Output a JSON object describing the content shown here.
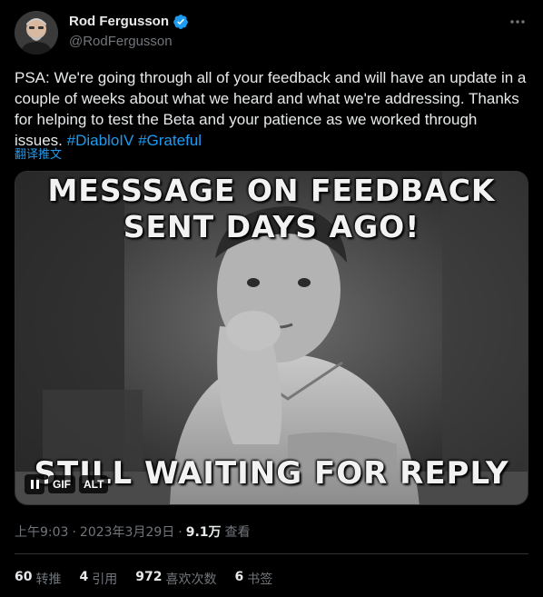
{
  "author": {
    "name": "Rod Fergusson",
    "handle": "@RodFergusson",
    "verified": true
  },
  "tweet": {
    "text": "PSA: We're going through all of your feedback and will have an update in a couple of weeks about what we heard and what we're addressing. Thanks for helping to test the Beta and your patience as we worked through issues. ",
    "hashtags": [
      "#DiabloIV",
      "#Grateful"
    ],
    "translate_label": "翻译推文"
  },
  "media": {
    "caption_top_line1": "MESSSAGE ON FEEDBACK",
    "caption_top_line2": "SENT  DAYS AGO!",
    "caption_bottom": "STILL WAITING FOR REPLY",
    "gif_badge": "GIF",
    "alt_badge": "ALT"
  },
  "meta": {
    "time": "上午9:03",
    "separator": "·",
    "date": "2023年3月29日",
    "views_count": "9.1万",
    "views_label": "查看"
  },
  "stats": {
    "retweets": {
      "count": "60",
      "label": "转推"
    },
    "quotes": {
      "count": "4",
      "label": "引用"
    },
    "likes": {
      "count": "972",
      "label": "喜欢次数"
    },
    "bookmarks": {
      "count": "6",
      "label": "书签"
    }
  },
  "colors": {
    "background": "#000000",
    "text_primary": "#e7e9ea",
    "text_secondary": "#71767b",
    "accent": "#1d9bf0",
    "border": "#2f3336"
  },
  "icons": {
    "verified": "verified-badge-icon",
    "more": "more-dots-icon",
    "pause": "pause-icon"
  }
}
